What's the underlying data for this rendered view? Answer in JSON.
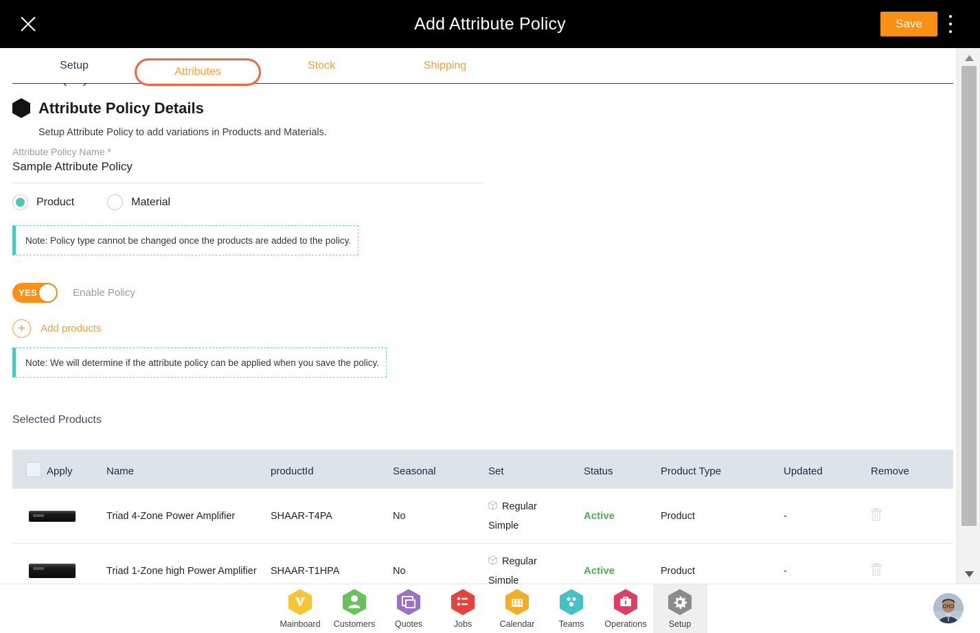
{
  "topbar": {
    "title": "Add Attribute Policy",
    "close_icon": "close-icon",
    "save_label": "Save",
    "menu_icon": "kebab-menu-icon",
    "save_color": "#FA9015"
  },
  "tabs": [
    {
      "label": "Setup",
      "state": "current"
    },
    {
      "label": "Attributes",
      "state": "highlighted"
    },
    {
      "label": "Stock",
      "state": "normal"
    },
    {
      "label": "Shipping",
      "state": "normal"
    }
  ],
  "highlight_color": "#F4633A",
  "details": {
    "icon": "hexagon-icon",
    "title": "Attribute Policy Details",
    "subtitle": "Setup Attribute Policy to add variations in Products and Materials.",
    "name_label": "Attribute Policy Name *",
    "name_value": "Sample Attribute Policy",
    "name_placeholder": "Attribute Policy Name"
  },
  "policy_type": {
    "options": [
      {
        "label": "Product",
        "selected": true
      },
      {
        "label": "Material",
        "selected": false
      }
    ],
    "selected_color": "#4DC7BE"
  },
  "note_1": "Note: Policy type cannot be changed once the products are added to the policy.",
  "note_2": "Note: We will determine if the attribute policy can be applied when you save the policy.",
  "note_accent_color": "#4DC6C0",
  "enable_policy": {
    "toggle_value": "YES",
    "label": "Enable Policy"
  },
  "add_products": {
    "icon": "plus-circle-icon",
    "label": "Add products"
  },
  "selected_products": {
    "title": "Selected Products",
    "columns": [
      "Apply",
      "Name",
      "productId",
      "Seasonal",
      "Set",
      "Status",
      "Product Type",
      "Updated",
      "Remove"
    ],
    "header_checkbox": "select-all-checkbox",
    "rows": [
      {
        "thumb": "power-amplifier-thumbnail",
        "name": "Triad 4-Zone Power Amplifier",
        "productId": "SHAAR-T4PA",
        "seasonal": "No",
        "set_line1": "Regular",
        "set_line2": "Simple",
        "set_icon": "cube-icon",
        "status": "Active",
        "product_type": "Product",
        "updated": "-",
        "remove_icon": "trash-icon"
      },
      {
        "thumb": "power-amplifier-thumbnail",
        "name": "Triad 1-Zone high Power Amplifier",
        "productId": "SHAAR-T1HPA",
        "seasonal": "No",
        "set_line1": "Regular",
        "set_line2": "Simple",
        "set_icon": "cube-icon",
        "status": "Active",
        "product_type": "Product",
        "updated": "-",
        "remove_icon": "trash-icon"
      }
    ],
    "status_color": "#4CAF50"
  },
  "bottom_nav": {
    "items": [
      {
        "label": "Mainboard",
        "icon": "mainboard-icon",
        "color": "#F7C531",
        "selected": false
      },
      {
        "label": "Customers",
        "icon": "customers-icon",
        "color": "#68C15B",
        "selected": false
      },
      {
        "label": "Quotes",
        "icon": "quotes-icon",
        "color": "#A06FC4",
        "selected": false
      },
      {
        "label": "Jobs",
        "icon": "jobs-icon",
        "color": "#E8433B",
        "selected": false
      },
      {
        "label": "Calendar",
        "icon": "calendar-icon",
        "color": "#F2AE26",
        "selected": false
      },
      {
        "label": "Teams",
        "icon": "teams-icon",
        "color": "#44C3C6",
        "selected": false
      },
      {
        "label": "Operations",
        "icon": "operations-icon",
        "color": "#E23C63",
        "selected": false
      },
      {
        "label": "Setup",
        "icon": "setup-gear-icon",
        "color": "#8C8C8C",
        "selected": true
      }
    ],
    "avatar": "user-avatar"
  },
  "scrollbar": {
    "up_icon": "scroll-up-arrow",
    "down_icon": "scroll-down-arrow"
  }
}
